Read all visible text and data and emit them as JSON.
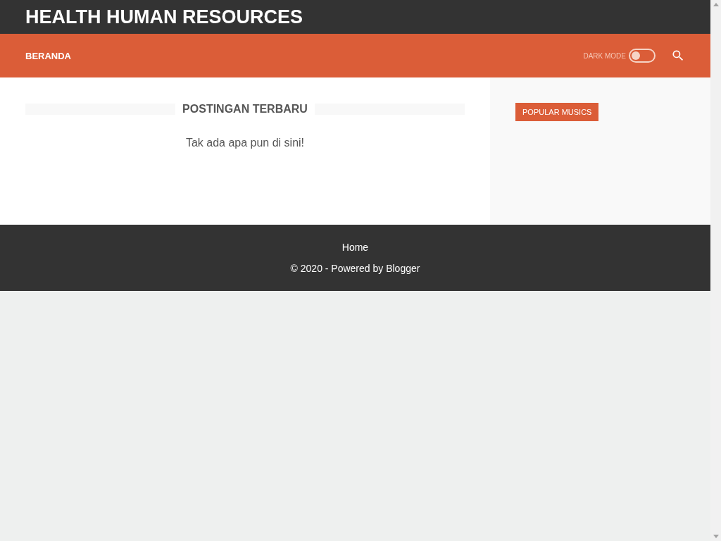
{
  "header": {
    "title": "HEALTH HUMAN RESOURCES"
  },
  "nav": {
    "items": [
      {
        "label": "BERANDA",
        "selected": true
      }
    ],
    "dark_mode": {
      "label": "DARK MODE",
      "on": false
    }
  },
  "main": {
    "heading": "POSTINGAN TERBARU",
    "empty_message": "Tak ada apa pun di sini!"
  },
  "sidebar": {
    "widget_title": "POPULAR MUSICS"
  },
  "footer": {
    "links": [
      "Home"
    ],
    "copyright": "© 2020 - Powered by Blogger"
  }
}
